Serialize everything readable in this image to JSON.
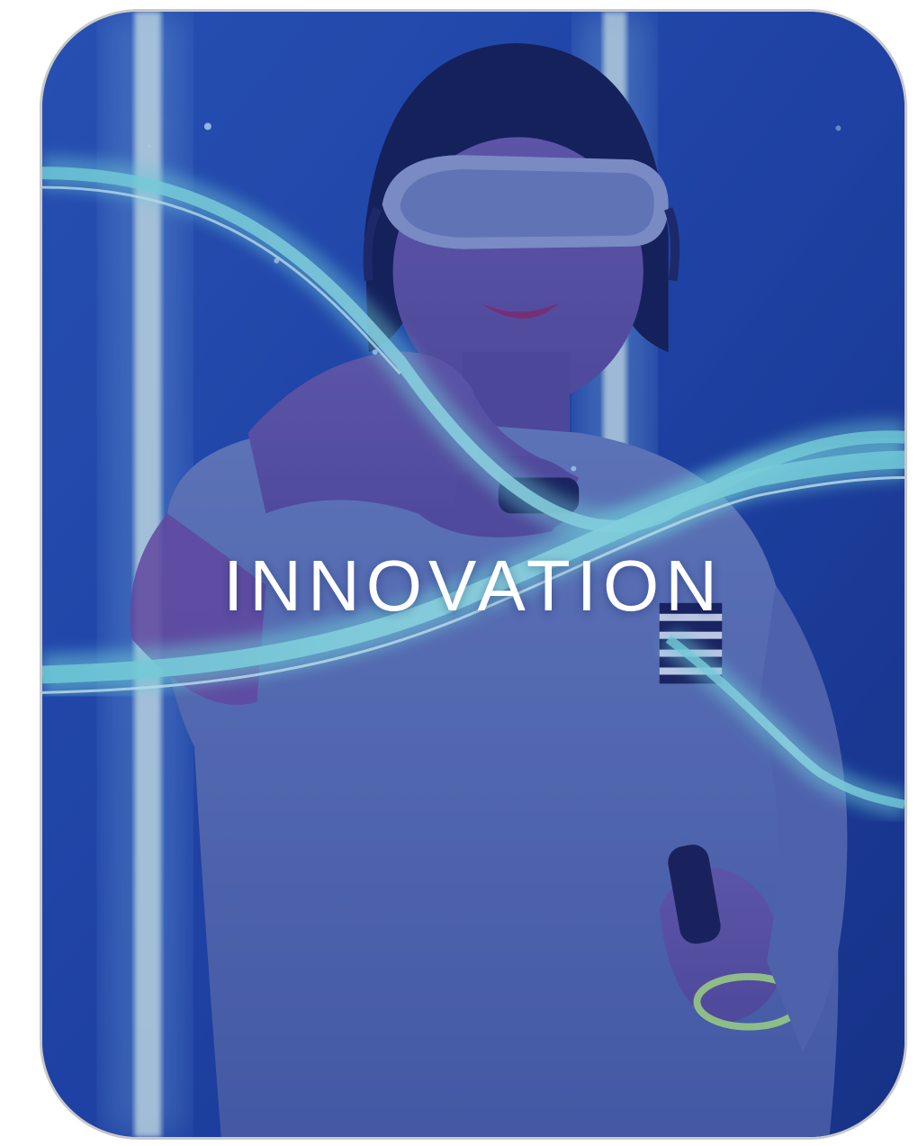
{
  "card": {
    "title": "INNOVATION"
  },
  "colors": {
    "background": "#1d3f9c",
    "light_trail": "#7fe6df",
    "neon_tube": "#cfe9e6",
    "title_text": "#ffffff"
  },
  "icons": {
    "photo": "vr-headset-person-photo"
  }
}
